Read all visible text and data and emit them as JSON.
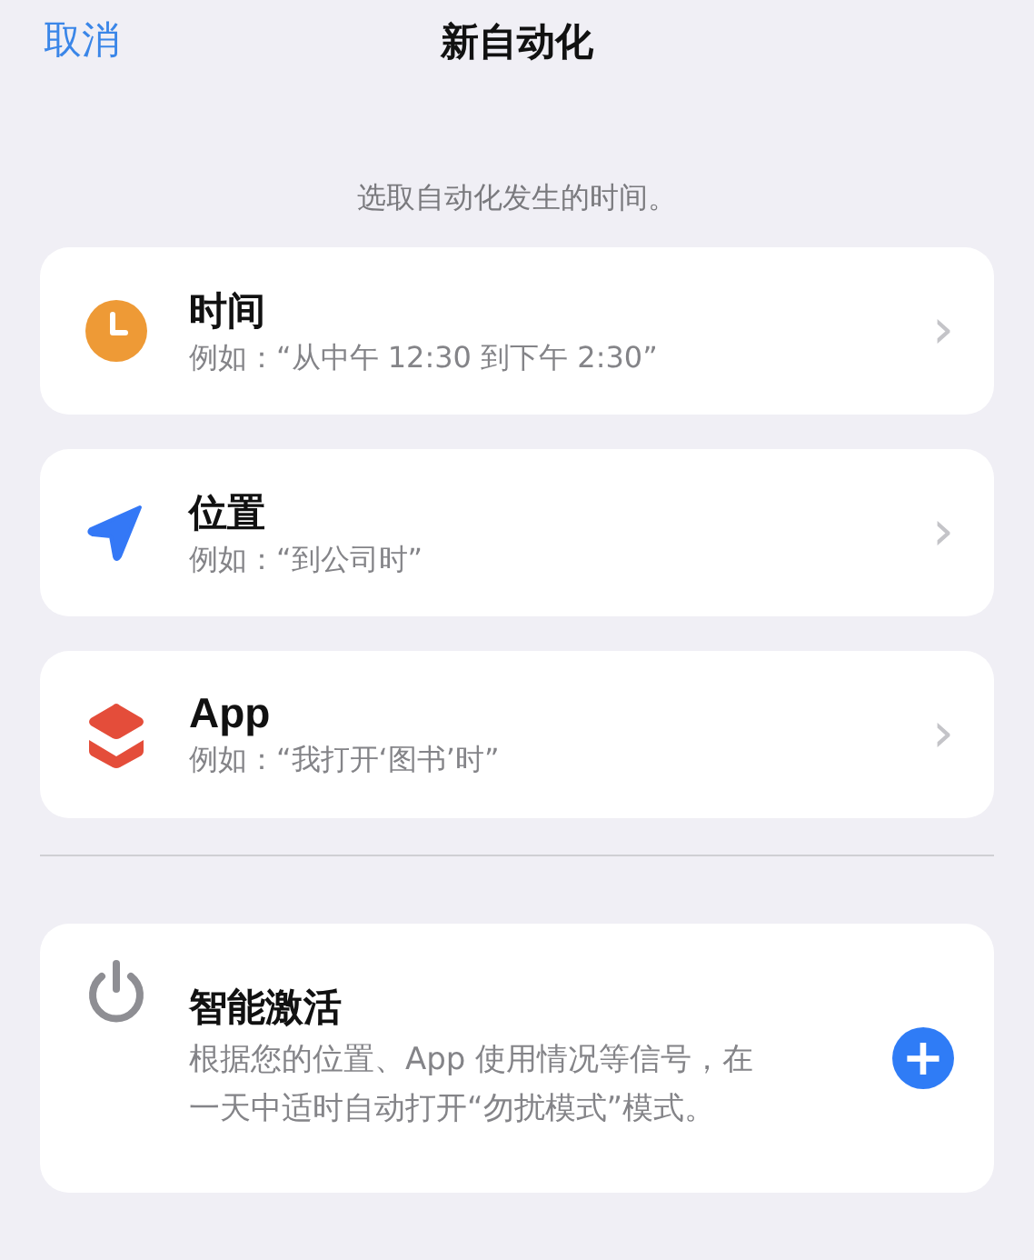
{
  "nav": {
    "cancel": "取消",
    "title": "新自动化"
  },
  "prompt": "选取自动化发生的时间。",
  "triggers": [
    {
      "kind": "time",
      "title": "时间",
      "example": "例如：“从中午 12:30 到下午 2:30”",
      "chevron": "›"
    },
    {
      "kind": "location",
      "title": "位置",
      "example": "例如：“到公司时”",
      "chevron": "›"
    },
    {
      "kind": "app",
      "title": "App",
      "example": "例如：“我打开‘图书’时”",
      "chevron": "›"
    }
  ],
  "smart": {
    "title": "智能激活",
    "description": "根据您的位置、App 使用情况等信号，在一天中适时自动打开“勿扰模式”模式。",
    "add": "+"
  }
}
